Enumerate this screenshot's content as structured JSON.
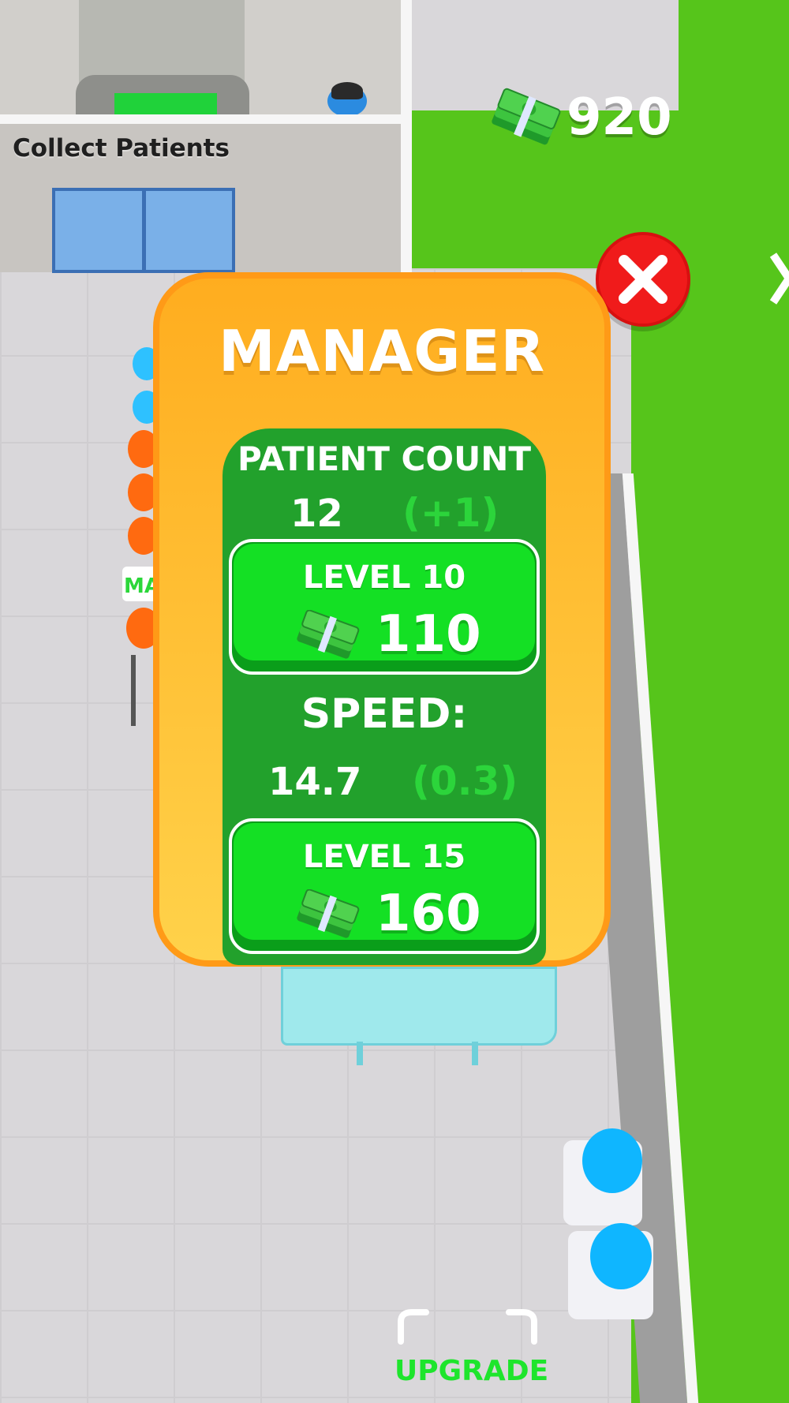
{
  "hud": {
    "money": "920",
    "collect_label": "Collect Patients",
    "floor_sign": "MA"
  },
  "panel": {
    "title": "MANAGER",
    "patient_count": {
      "label": "PATIENT COUNT",
      "value": "12",
      "bonus": "(+1)",
      "upgrade_level": "LEVEL 10",
      "upgrade_cost": "110"
    },
    "speed": {
      "label": "SPEED:",
      "value": "14.7",
      "bonus": "(0.3)",
      "upgrade_level": "LEVEL 15",
      "upgrade_cost": "160"
    }
  },
  "upgrade_zone": {
    "label": "UPGRADE"
  },
  "colors": {
    "panel_orange": "#ffad1f",
    "card_green": "#22a12c",
    "button_green": "#14e024",
    "bonus_green": "#2cd53b",
    "close_red": "#f01b1b",
    "grass": "#56c51b"
  },
  "icons": [
    "cash-stack-icon",
    "close-icon"
  ]
}
